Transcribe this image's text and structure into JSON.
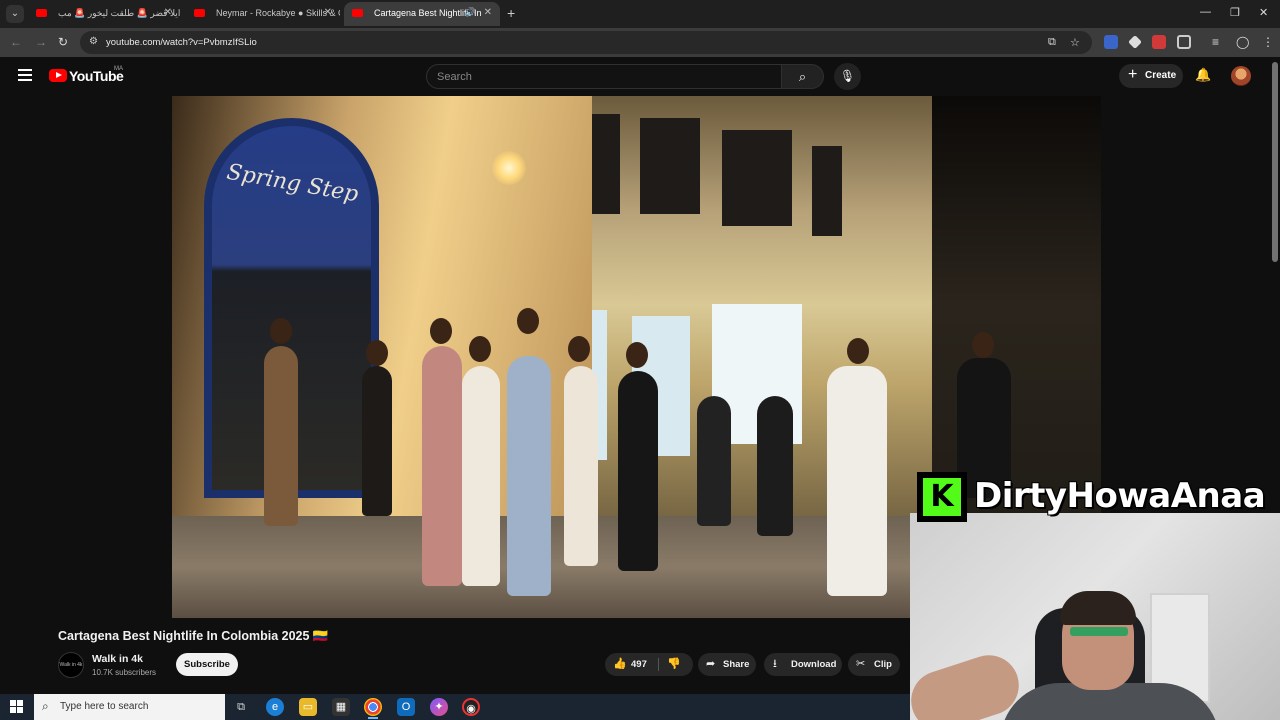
{
  "browser": {
    "tabs": [
      {
        "title": "ايلا قضر 🚨 طلقت ليخور 🚨 مب",
        "active": false,
        "audio": false
      },
      {
        "title": "Neymar - Rockabye ● Skills & G",
        "active": false,
        "audio": false
      },
      {
        "title": "Cartagena Best Nightlife In",
        "active": true,
        "audio": true
      }
    ],
    "new_tab_label": "+",
    "url": "youtube.com/watch?v=PvbmzIfSLio"
  },
  "youtube": {
    "logo_text": "YouTube",
    "country_code": "MA",
    "search_placeholder": "Search",
    "create_label": "Create",
    "video": {
      "title": "Cartagena Best Nightlife In Colombia 2025 🇨🇴",
      "channel_name": "Walk in 4k",
      "subscribers": "10.7K subscribers",
      "channel_avatar_text": "Walk in 4k",
      "subscribe_label": "Subscribe",
      "likes": "497",
      "share_label": "Share",
      "download_label": "Download",
      "clip_label": "Clip",
      "storefront_sign": "Spring Step"
    }
  },
  "stream_overlay": {
    "platform_letter": "K",
    "streamer_name": "DirtyHowaAnaa"
  },
  "taskbar": {
    "search_placeholder": "Type here to search"
  },
  "colors": {
    "youtube_red": "#ff0000",
    "kick_green": "#53fc18",
    "page_bg": "#0f0f0f"
  }
}
